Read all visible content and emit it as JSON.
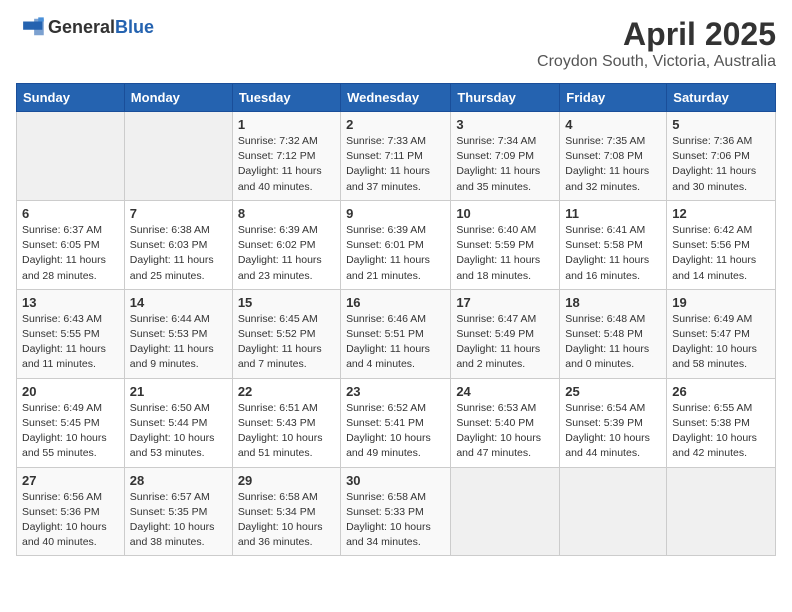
{
  "header": {
    "logo_general": "General",
    "logo_blue": "Blue",
    "title": "April 2025",
    "subtitle": "Croydon South, Victoria, Australia"
  },
  "weekdays": [
    "Sunday",
    "Monday",
    "Tuesday",
    "Wednesday",
    "Thursday",
    "Friday",
    "Saturday"
  ],
  "weeks": [
    [
      {
        "day": "",
        "info": ""
      },
      {
        "day": "",
        "info": ""
      },
      {
        "day": "1",
        "info": "Sunrise: 7:32 AM\nSunset: 7:12 PM\nDaylight: 11 hours and 40 minutes."
      },
      {
        "day": "2",
        "info": "Sunrise: 7:33 AM\nSunset: 7:11 PM\nDaylight: 11 hours and 37 minutes."
      },
      {
        "day": "3",
        "info": "Sunrise: 7:34 AM\nSunset: 7:09 PM\nDaylight: 11 hours and 35 minutes."
      },
      {
        "day": "4",
        "info": "Sunrise: 7:35 AM\nSunset: 7:08 PM\nDaylight: 11 hours and 32 minutes."
      },
      {
        "day": "5",
        "info": "Sunrise: 7:36 AM\nSunset: 7:06 PM\nDaylight: 11 hours and 30 minutes."
      }
    ],
    [
      {
        "day": "6",
        "info": "Sunrise: 6:37 AM\nSunset: 6:05 PM\nDaylight: 11 hours and 28 minutes."
      },
      {
        "day": "7",
        "info": "Sunrise: 6:38 AM\nSunset: 6:03 PM\nDaylight: 11 hours and 25 minutes."
      },
      {
        "day": "8",
        "info": "Sunrise: 6:39 AM\nSunset: 6:02 PM\nDaylight: 11 hours and 23 minutes."
      },
      {
        "day": "9",
        "info": "Sunrise: 6:39 AM\nSunset: 6:01 PM\nDaylight: 11 hours and 21 minutes."
      },
      {
        "day": "10",
        "info": "Sunrise: 6:40 AM\nSunset: 5:59 PM\nDaylight: 11 hours and 18 minutes."
      },
      {
        "day": "11",
        "info": "Sunrise: 6:41 AM\nSunset: 5:58 PM\nDaylight: 11 hours and 16 minutes."
      },
      {
        "day": "12",
        "info": "Sunrise: 6:42 AM\nSunset: 5:56 PM\nDaylight: 11 hours and 14 minutes."
      }
    ],
    [
      {
        "day": "13",
        "info": "Sunrise: 6:43 AM\nSunset: 5:55 PM\nDaylight: 11 hours and 11 minutes."
      },
      {
        "day": "14",
        "info": "Sunrise: 6:44 AM\nSunset: 5:53 PM\nDaylight: 11 hours and 9 minutes."
      },
      {
        "day": "15",
        "info": "Sunrise: 6:45 AM\nSunset: 5:52 PM\nDaylight: 11 hours and 7 minutes."
      },
      {
        "day": "16",
        "info": "Sunrise: 6:46 AM\nSunset: 5:51 PM\nDaylight: 11 hours and 4 minutes."
      },
      {
        "day": "17",
        "info": "Sunrise: 6:47 AM\nSunset: 5:49 PM\nDaylight: 11 hours and 2 minutes."
      },
      {
        "day": "18",
        "info": "Sunrise: 6:48 AM\nSunset: 5:48 PM\nDaylight: 11 hours and 0 minutes."
      },
      {
        "day": "19",
        "info": "Sunrise: 6:49 AM\nSunset: 5:47 PM\nDaylight: 10 hours and 58 minutes."
      }
    ],
    [
      {
        "day": "20",
        "info": "Sunrise: 6:49 AM\nSunset: 5:45 PM\nDaylight: 10 hours and 55 minutes."
      },
      {
        "day": "21",
        "info": "Sunrise: 6:50 AM\nSunset: 5:44 PM\nDaylight: 10 hours and 53 minutes."
      },
      {
        "day": "22",
        "info": "Sunrise: 6:51 AM\nSunset: 5:43 PM\nDaylight: 10 hours and 51 minutes."
      },
      {
        "day": "23",
        "info": "Sunrise: 6:52 AM\nSunset: 5:41 PM\nDaylight: 10 hours and 49 minutes."
      },
      {
        "day": "24",
        "info": "Sunrise: 6:53 AM\nSunset: 5:40 PM\nDaylight: 10 hours and 47 minutes."
      },
      {
        "day": "25",
        "info": "Sunrise: 6:54 AM\nSunset: 5:39 PM\nDaylight: 10 hours and 44 minutes."
      },
      {
        "day": "26",
        "info": "Sunrise: 6:55 AM\nSunset: 5:38 PM\nDaylight: 10 hours and 42 minutes."
      }
    ],
    [
      {
        "day": "27",
        "info": "Sunrise: 6:56 AM\nSunset: 5:36 PM\nDaylight: 10 hours and 40 minutes."
      },
      {
        "day": "28",
        "info": "Sunrise: 6:57 AM\nSunset: 5:35 PM\nDaylight: 10 hours and 38 minutes."
      },
      {
        "day": "29",
        "info": "Sunrise: 6:58 AM\nSunset: 5:34 PM\nDaylight: 10 hours and 36 minutes."
      },
      {
        "day": "30",
        "info": "Sunrise: 6:58 AM\nSunset: 5:33 PM\nDaylight: 10 hours and 34 minutes."
      },
      {
        "day": "",
        "info": ""
      },
      {
        "day": "",
        "info": ""
      },
      {
        "day": "",
        "info": ""
      }
    ]
  ]
}
